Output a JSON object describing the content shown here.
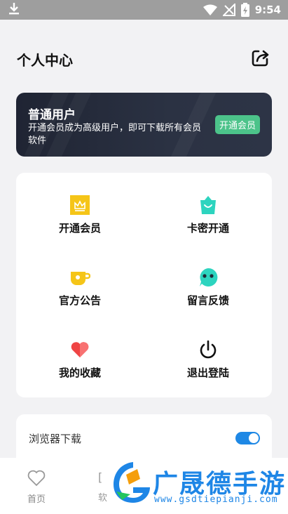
{
  "status_bar": {
    "time": "9:54",
    "icons": [
      "download-icon",
      "wifi-icon",
      "signal-icon",
      "battery-charging-icon"
    ]
  },
  "header": {
    "title": "个人中心",
    "share_icon": "share-icon"
  },
  "vip_banner": {
    "user_type": "普通用户",
    "description": "开通会员成为高级用户，即可下载所有会员软件",
    "button_label": "开通会员",
    "button_color": "#4cc38a"
  },
  "menu": {
    "items": [
      {
        "label": "开通会员",
        "icon": "crown-icon",
        "color": "#f5c518"
      },
      {
        "label": "卡密开通",
        "icon": "shopping-bag-icon",
        "color": "#2dd4bf"
      },
      {
        "label": "官方公告",
        "icon": "mug-icon",
        "color": "#f5c518"
      },
      {
        "label": "留言反馈",
        "icon": "chat-face-icon",
        "color": "#2dd4bf"
      },
      {
        "label": "我的收藏",
        "icon": "heart-icon",
        "color": "#ef4444"
      },
      {
        "label": "退出登陆",
        "icon": "power-icon",
        "color": "#111111"
      }
    ]
  },
  "settings": {
    "browser_download_label": "浏览器下载",
    "browser_download_enabled": true,
    "toggle_color": "#1e88e5"
  },
  "bottom_nav": {
    "home_label": "首页",
    "partial_icon_glyph": "[",
    "partial_label": "软"
  },
  "watermark": {
    "text": "广晟德手游",
    "url": "www.gsdtiepianji.com",
    "color": "#1e86e6"
  }
}
